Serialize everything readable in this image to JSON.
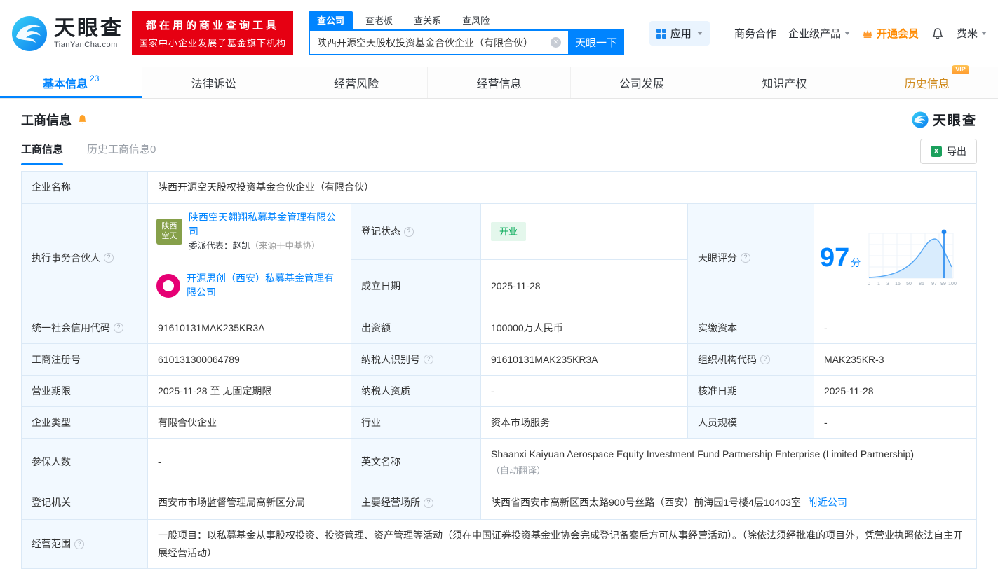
{
  "header": {
    "logo": {
      "title": "天眼查",
      "subtitle": "TianYanCha.com"
    },
    "promo": {
      "line1": "都在用的商业查询工具",
      "line2": "国家中小企业发展子基金旗下机构"
    },
    "search": {
      "tabs": [
        {
          "label": "查公司"
        },
        {
          "label": "查老板"
        },
        {
          "label": "查关系"
        },
        {
          "label": "查风险"
        }
      ],
      "value": "陕西开源空天股权投资基金合伙企业（有限合伙）",
      "button": "天眼一下"
    },
    "nav": {
      "apps": "应用",
      "biz": "商务合作",
      "enterprise": "企业级产品",
      "vip": "开通会员",
      "user": "费米"
    }
  },
  "tabs": [
    {
      "label": "基本信息",
      "count": "23"
    },
    {
      "label": "法律诉讼"
    },
    {
      "label": "经营风险"
    },
    {
      "label": "经营信息"
    },
    {
      "label": "公司发展"
    },
    {
      "label": "知识产权"
    },
    {
      "label": "历史信息",
      "badge": "VIP"
    }
  ],
  "section": {
    "title": "工商信息",
    "brand": "天眼查",
    "subtabs": [
      {
        "label": "工商信息"
      },
      {
        "label": "历史工商信息0"
      }
    ],
    "export_label": "导出"
  },
  "info": {
    "company_name": {
      "label": "企业名称",
      "value": "陕西开源空天股权投资基金合伙企业（有限合伙）"
    },
    "partners": {
      "label": "执行事务合伙人",
      "items": [
        {
          "logo_line1": "陕西",
          "logo_line2": "空天",
          "name": "陕西空天翱翔私募基金管理有限公司",
          "rep_prefix": "委派代表：",
          "rep_name": "赵凯",
          "rep_note": "（来源于中基协）"
        },
        {
          "name": "开源思创（西安）私募基金管理有限公司"
        }
      ]
    },
    "reg_status": {
      "label": "登记状态",
      "value": "开业"
    },
    "establish_date": {
      "label": "成立日期",
      "value": "2025-11-28"
    },
    "score": {
      "label": "天眼评分",
      "value": "97",
      "unit": "分",
      "axis": [
        "0",
        "1",
        "3",
        "15",
        "50",
        "85",
        "97",
        "99",
        "100"
      ]
    },
    "credit_code": {
      "label": "统一社会信用代码",
      "value": "91610131MAK235KR3A"
    },
    "capital": {
      "label": "出资额",
      "value": "100000万人民币"
    },
    "paid_capital": {
      "label": "实缴资本",
      "value": "-"
    },
    "reg_number": {
      "label": "工商注册号",
      "value": "610131300064789"
    },
    "taxpayer_id": {
      "label": "纳税人识别号",
      "value": "91610131MAK235KR3A"
    },
    "org_code": {
      "label": "组织机构代码",
      "value": "MAK235KR-3"
    },
    "business_term": {
      "label": "营业期限",
      "value": "2025-11-28 至 无固定期限"
    },
    "taxpayer_quality": {
      "label": "纳税人资质",
      "value": "-"
    },
    "approval_date": {
      "label": "核准日期",
      "value": "2025-11-28"
    },
    "company_type": {
      "label": "企业类型",
      "value": "有限合伙企业"
    },
    "industry": {
      "label": "行业",
      "value": "资本市场服务"
    },
    "staff_size": {
      "label": "人员规模",
      "value": "-"
    },
    "insured_count": {
      "label": "参保人数",
      "value": "-"
    },
    "english_name": {
      "label": "英文名称",
      "value": "Shaanxi Kaiyuan Aerospace Equity Investment Fund Partnership Enterprise (Limited Partnership)",
      "note": "（自动翻译）"
    },
    "reg_authority": {
      "label": "登记机关",
      "value": "西安市市场监督管理局高新区分局"
    },
    "address": {
      "label": "主要经营场所",
      "value": "陕西省西安市高新区西太路900号丝路（西安）前海园1号楼4层10403室",
      "link": "附近公司"
    },
    "business_scope": {
      "label": "经营范围",
      "value": "一般项目：以私募基金从事股权投资、投资管理、资产管理等活动（须在中国证券投资基金业协会完成登记备案后方可从事经营活动）。（除依法须经批准的项目外，凭营业执照依法自主开展经营活动）"
    }
  },
  "colors": {
    "primary_blue": "#0084ff",
    "promo_red": "#e60012",
    "vip_orange": "#ff8a00",
    "status_green": "#00a854",
    "label_bg": "#f2f9ff",
    "table_border": "#dbe9f6"
  }
}
